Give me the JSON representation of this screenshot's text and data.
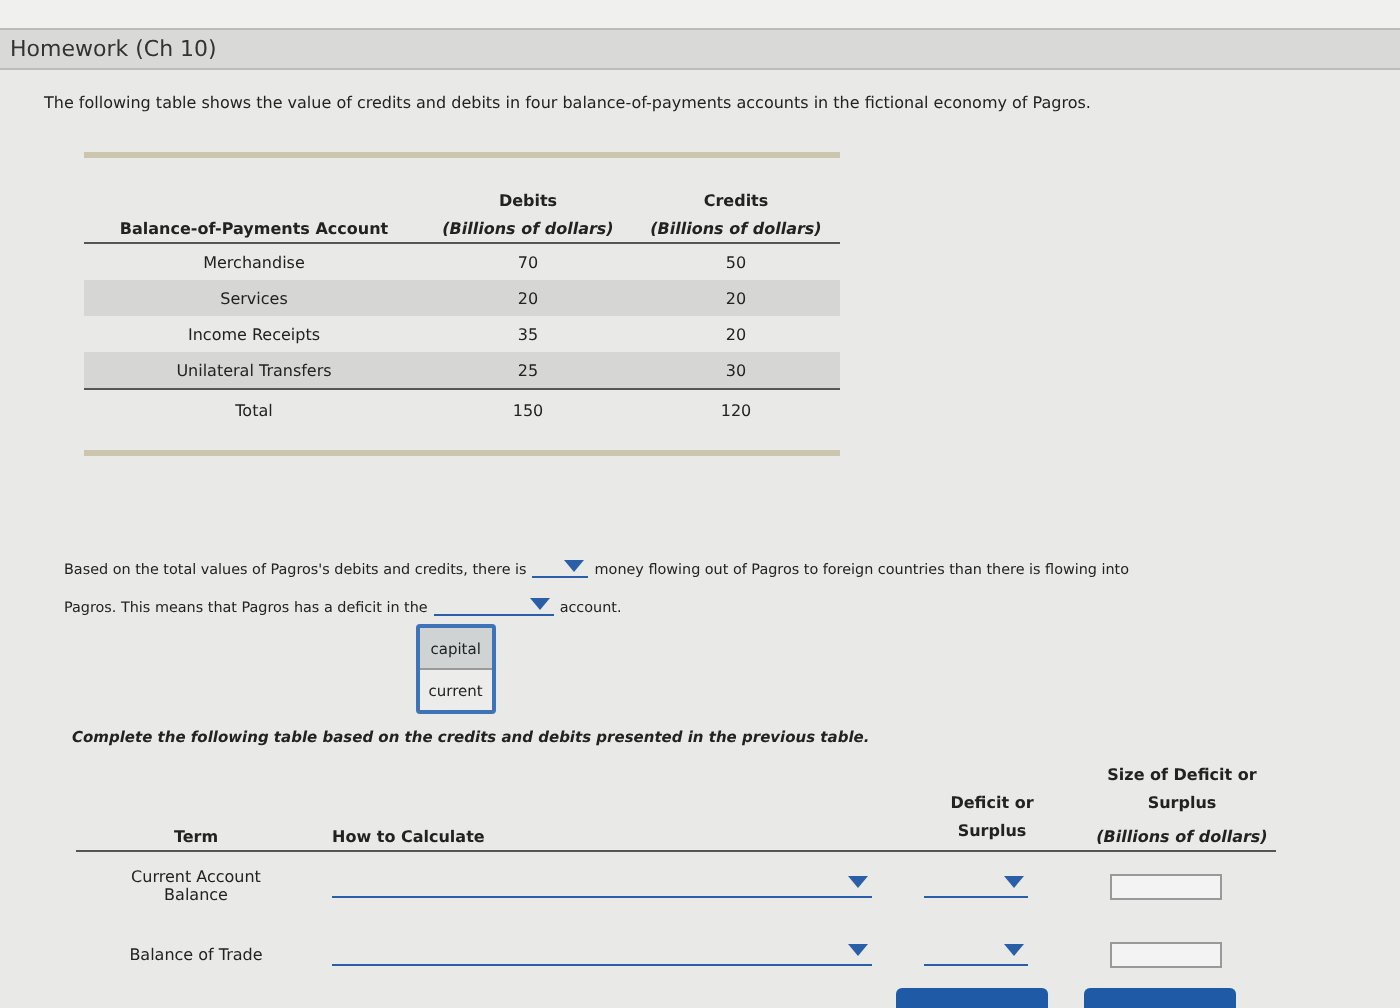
{
  "title": "Homework (Ch 10)",
  "intro": "The following table shows the value of credits and debits in four balance-of-payments accounts in the fictional economy of Pagros.",
  "accounts_table": {
    "columns": [
      {
        "title": "Balance-of-Payments Account"
      },
      {
        "title": "Debits",
        "unit": "(Billions of dollars)"
      },
      {
        "title": "Credits",
        "unit": "(Billions of dollars)"
      }
    ],
    "rows": [
      {
        "cells": [
          "Merchandise",
          "70",
          "50"
        ]
      },
      {
        "cells": [
          "Services",
          "20",
          "20"
        ]
      },
      {
        "cells": [
          "Income Receipts",
          "35",
          "20"
        ]
      },
      {
        "cells": [
          "Unilateral Transfers",
          "25",
          "30"
        ]
      }
    ],
    "total": [
      "Total",
      "150",
      "120"
    ]
  },
  "question": {
    "text_1": "Based on the total values of Pagros's debits and credits, there is",
    "text_2": "money flowing out of Pagros to foreign countries than there is flowing into",
    "text_3_start": "Pagros. This means that Pagros has a deficit in the",
    "text_3": "account.",
    "open_menu": [
      {
        "label": "capital",
        "selected": true
      },
      {
        "label": "current",
        "selected": false
      }
    ]
  },
  "instructions": "Complete the following table based on the credits and debits presented in the previous table.",
  "answer_table": {
    "columns": [
      {
        "title": "Term"
      },
      {
        "title": "How to Calculate"
      },
      {
        "title": "Deficit or Surplus"
      },
      {
        "title": "Size of Deficit or Surplus",
        "unit": "(Billions of dollars)"
      }
    ],
    "rows": [
      {
        "term": "Current Account Balance"
      },
      {
        "term": "Balance of Trade"
      }
    ]
  }
}
